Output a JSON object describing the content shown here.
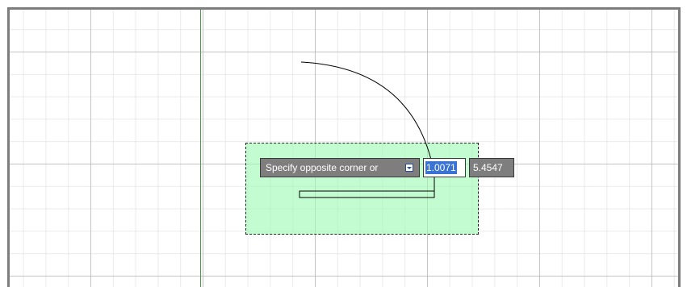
{
  "colors": {
    "selection_fill": "#a0fab4",
    "y_axis": "#4a9a4a",
    "tooltip_bg": "#7e7e7e",
    "input_highlight": "#3a73d1",
    "grid_major": "#a5a5a5",
    "viewport_border": "#7d7d7d"
  },
  "dynamic_input": {
    "prompt": "Specify opposite corner or",
    "expand_icon": "chevron-down-icon",
    "x_value": "1.0071",
    "y_value": "5.4547"
  }
}
